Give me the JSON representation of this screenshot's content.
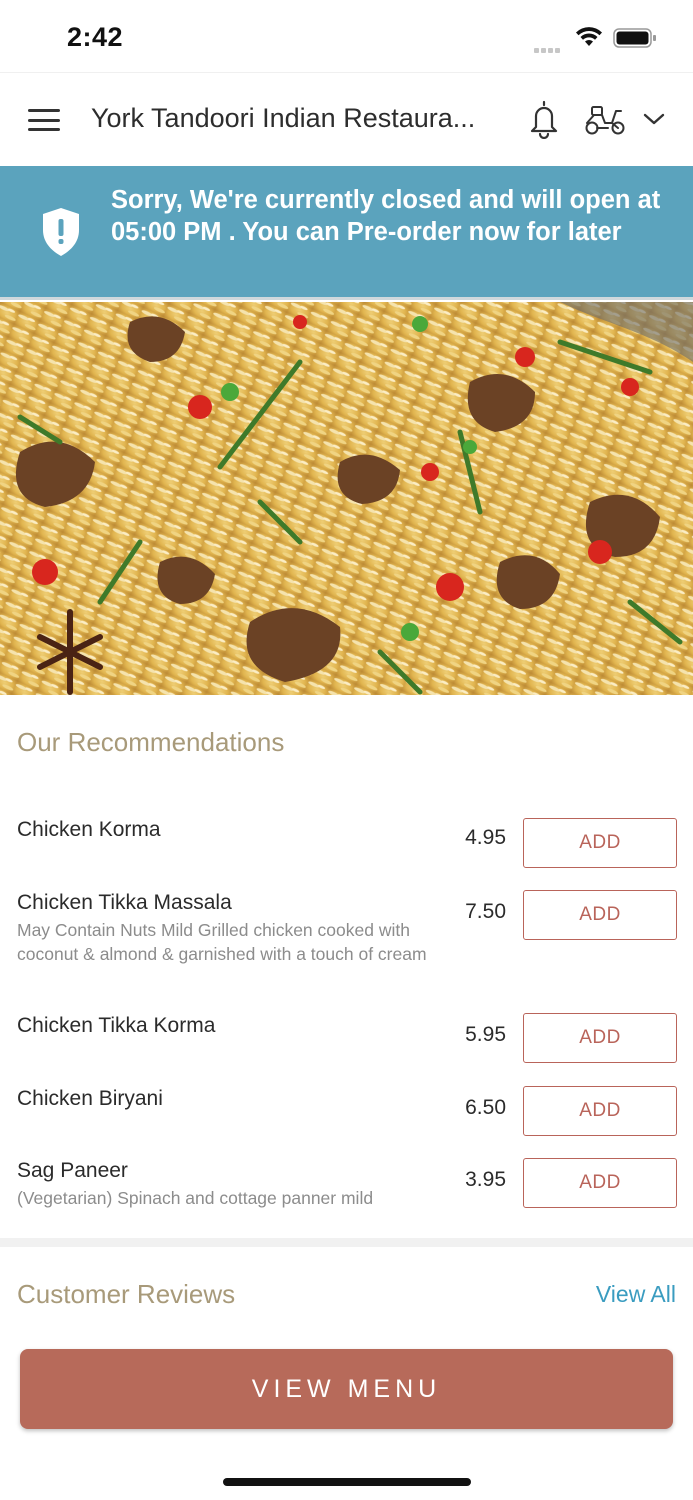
{
  "status_bar": {
    "time": "2:42"
  },
  "header": {
    "title": "York Tandoori Indian Restaura...",
    "icons": [
      "menu-icon",
      "bell-icon",
      "scooter-icon",
      "chevron-down-icon"
    ]
  },
  "banner": {
    "icon": "shield-alert-icon",
    "message": "Sorry, We're currently closed and will open at 05:00 PM . You can Pre-order now for later",
    "color": "#5ba3bd"
  },
  "recommendations": {
    "title": "Our Recommendations",
    "items": [
      {
        "name": "Chicken Korma",
        "description": "",
        "price": "4.95",
        "button": "ADD"
      },
      {
        "name": "Chicken Tikka Massala",
        "description": "May Contain Nuts  Mild  Grilled chicken cooked with coconut & almond &  garnished with a touch of cream",
        "price": "7.50",
        "button": "ADD"
      },
      {
        "name": "Chicken Tikka Korma",
        "description": "",
        "price": "5.95",
        "button": "ADD"
      },
      {
        "name": "Chicken Biryani",
        "description": "",
        "price": "6.50",
        "button": "ADD"
      },
      {
        "name": "Sag Paneer",
        "description": "(Vegetarian) Spinach and cottage panner mild",
        "price": "3.95",
        "button": "ADD"
      }
    ]
  },
  "reviews": {
    "title": "Customer Reviews",
    "view_all": "View All"
  },
  "footer": {
    "view_menu": "VIEW MENU"
  },
  "colors": {
    "accent": "#b76a5a",
    "link": "#3a9cc0",
    "section_title": "#a89a7a"
  }
}
